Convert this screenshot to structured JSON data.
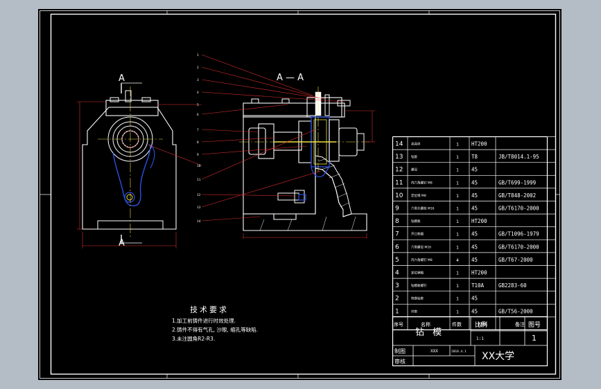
{
  "section": {
    "left_label_top": "A",
    "left_label_bottom": "A",
    "right_title": "A — A"
  },
  "leaders": [
    "1",
    "2",
    "3",
    "4",
    "5",
    "6",
    "7",
    "8",
    "9",
    "10",
    "11",
    "12",
    "13",
    "14"
  ],
  "notes": {
    "title": "技术要求",
    "items": [
      "1.加工前铸件进行时效处理.",
      "2.铸件不得有气孔, 沙眼, 缩孔等缺陷.",
      "3.未注圆角R2-R3."
    ]
  },
  "bom": {
    "header": {
      "no": "序号",
      "name": "名称",
      "qty": "件数",
      "material": "材料",
      "note": "备注"
    },
    "rows": [
      {
        "no": "14",
        "name": "夹具体",
        "qty": "1",
        "material": "HT200",
        "note": ""
      },
      {
        "no": "13",
        "name": "钻套",
        "qty": "1",
        "material": "T8",
        "note": "JB/T8014.1-95"
      },
      {
        "no": "12",
        "name": "螺母",
        "qty": "1",
        "material": "45",
        "note": ""
      },
      {
        "no": "11",
        "name": "内六角螺钉 M8",
        "qty": "1",
        "material": "45",
        "note": "GB/T699-1999"
      },
      {
        "no": "10",
        "name": "定位销 M8",
        "qty": "1",
        "material": "45",
        "note": "GB/T848-2002"
      },
      {
        "no": "9",
        "name": "六角头螺栓 M16",
        "qty": "1",
        "material": "45",
        "note": "GB/T6170-2000"
      },
      {
        "no": "8",
        "name": "钻模板",
        "qty": "1",
        "material": "HT200",
        "note": ""
      },
      {
        "no": "7",
        "name": "开口垫圈",
        "qty": "1",
        "material": "45",
        "note": "GB/T1096-1979"
      },
      {
        "no": "6",
        "name": "六角螺母 M16",
        "qty": "1",
        "material": "45",
        "note": "GB/T6170-2000"
      },
      {
        "no": "5",
        "name": "内六角螺钉 M8",
        "qty": "4",
        "material": "45",
        "note": "GB/T67-2000"
      },
      {
        "no": "4",
        "name": "定位销轴",
        "qty": "1",
        "material": "HT200",
        "note": ""
      },
      {
        "no": "3",
        "name": "钻模板螺钉",
        "qty": "1",
        "material": "T10A",
        "note": "GB2283-60"
      },
      {
        "no": "2",
        "name": "快换钻套",
        "qty": "1",
        "material": "45",
        "note": ""
      },
      {
        "no": "1",
        "name": "衬套",
        "qty": "1",
        "material": "45",
        "note": "GB/T56-2000"
      }
    ]
  },
  "title_block": {
    "drawing_name": "钻 模",
    "scale_label": "比例",
    "drawing_no_label": "图号",
    "scale_value": "1:1",
    "drawing_no_value": "1",
    "drawn_label": "制图",
    "drawn_value": "XXX",
    "date_value": "2018.4.1",
    "checked_label": "审核",
    "school": "XX大学"
  }
}
